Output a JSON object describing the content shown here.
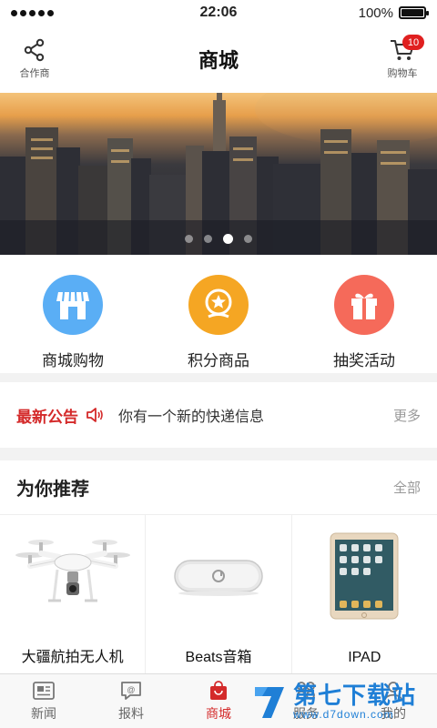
{
  "status_bar": {
    "time": "22:06",
    "battery": "100%"
  },
  "nav": {
    "title": "商城",
    "left_label": "合作商",
    "left_icon": "share-icon",
    "right_label": "购物车",
    "right_icon": "cart-icon",
    "cart_count": "10"
  },
  "banner": {
    "slide_count": 4,
    "active_index": 2
  },
  "categories": [
    {
      "label": "商城购物",
      "icon": "store-icon",
      "color": "#5aaef5"
    },
    {
      "label": "积分商品",
      "icon": "badge-icon",
      "color": "#f5a623"
    },
    {
      "label": "抽奖活动",
      "icon": "gift-icon",
      "color": "#f56a5a"
    }
  ],
  "notice": {
    "title": "最新公告",
    "text": "你有一个新的快递信息",
    "more": "更多"
  },
  "recommend": {
    "title": "为你推荐",
    "all": "全部",
    "products": [
      {
        "name": "大疆航拍无人机"
      },
      {
        "name": "Beats音箱"
      },
      {
        "name": "IPAD"
      }
    ]
  },
  "tabs": [
    {
      "label": "新闻",
      "icon": "newspaper-icon"
    },
    {
      "label": "报料",
      "icon": "report-icon"
    },
    {
      "label": "商城",
      "icon": "shopping-bag-icon",
      "active": true
    },
    {
      "label": "服务",
      "icon": "service-icon"
    },
    {
      "label": "我的",
      "icon": "user-icon"
    }
  ],
  "watermark": {
    "brand": "第七下载站",
    "url": "www.d7down.com"
  },
  "colors": {
    "accent": "#d42a2a",
    "watermark": "#1f7fd6"
  }
}
